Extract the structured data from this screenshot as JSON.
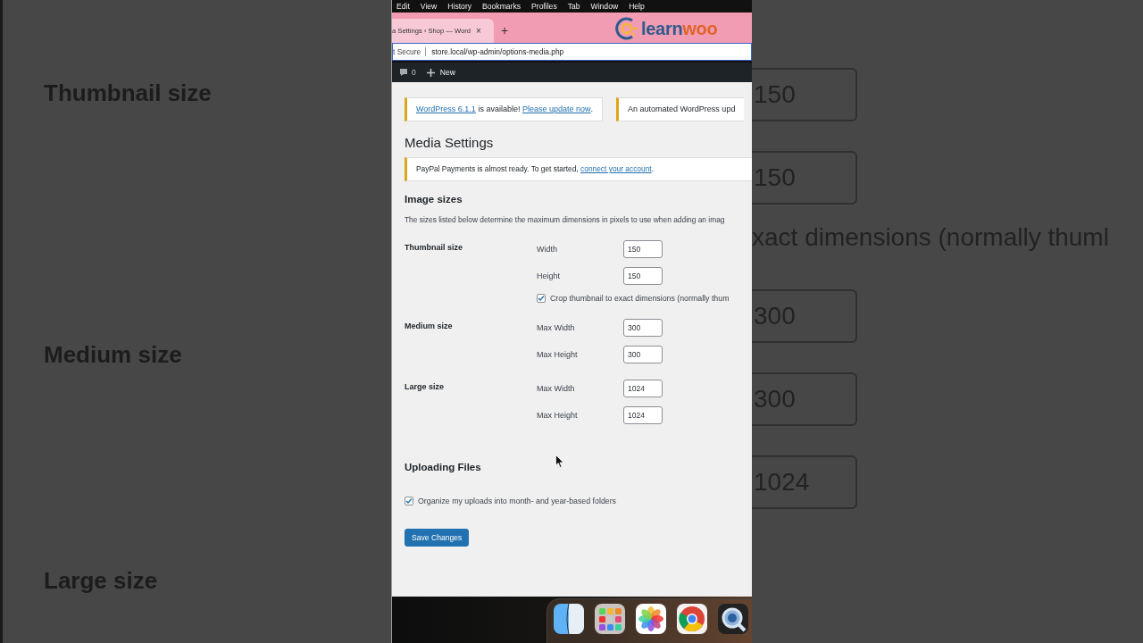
{
  "backdrop_left": {
    "labels": [
      "Thumbnail size",
      "Medium size",
      "Large size"
    ]
  },
  "backdrop_right": {
    "items": [
      {
        "kind": "field",
        "text": "150"
      },
      {
        "kind": "field",
        "text": "150"
      },
      {
        "kind": "text",
        "text": "xact dimensions (normally thuml"
      },
      {
        "kind": "field",
        "text": "300"
      },
      {
        "kind": "field",
        "text": "300"
      },
      {
        "kind": "field",
        "text": "1024"
      }
    ]
  },
  "menubar": {
    "items": [
      "Edit",
      "View",
      "History",
      "Bookmarks",
      "Profiles",
      "Tab",
      "Window",
      "Help"
    ]
  },
  "browser": {
    "tab": {
      "title": "a Settings ‹ Shop — Word",
      "close": "×",
      "selected": true
    },
    "new_tab": "+",
    "logo": {
      "part_1": "learn",
      "part_2": "woo"
    },
    "address": {
      "security": "t Secure",
      "url": "store.local/wp-admin/options-media.php"
    }
  },
  "admin_bar": {
    "comments": "0",
    "new": "New"
  },
  "notices": [
    {
      "kind": "update",
      "parts": [
        {
          "text": "WordPress 6.1.1",
          "link": true
        },
        {
          "text": " is available! ",
          "link": false
        },
        {
          "text": "Please update now",
          "link": true
        },
        {
          "text": ".",
          "link": false
        }
      ]
    },
    {
      "kind": "update",
      "parts": [
        {
          "text": "An automated WordPress upd",
          "link": false
        }
      ]
    }
  ],
  "page_title": "Media Settings",
  "paypal_notice": {
    "parts": [
      {
        "text": "PayPal Payments is almost ready. To get started, ",
        "link": false
      },
      {
        "text": "connect your account",
        "link": true
      },
      {
        "text": ".",
        "link": false
      }
    ]
  },
  "image_sizes": {
    "title": "Image sizes",
    "description": "The sizes listed below determine the maximum dimensions in pixels to use when adding an imag",
    "groups": [
      {
        "label": "Thumbnail size",
        "rows": [
          {
            "kind": "number",
            "label": "Width",
            "value": "150"
          },
          {
            "kind": "number",
            "label": "Height",
            "value": "150"
          },
          {
            "kind": "checkbox",
            "label": "Crop thumbnail to exact dimensions (normally thum",
            "checked": true
          }
        ]
      },
      {
        "label": "Medium size",
        "rows": [
          {
            "kind": "number",
            "label": "Max Width",
            "value": "300"
          },
          {
            "kind": "number",
            "label": "Max Height",
            "value": "300"
          }
        ]
      },
      {
        "label": "Large size",
        "rows": [
          {
            "kind": "number",
            "label": "Max Width",
            "value": "1024"
          },
          {
            "kind": "number",
            "label": "Max Height",
            "value": "1024"
          }
        ]
      }
    ]
  },
  "uploading": {
    "title": "Uploading Files",
    "options": [
      {
        "label": "Organize my uploads into month- and year-based folders",
        "checked": true
      }
    ]
  },
  "save_button": "Save Changes"
}
